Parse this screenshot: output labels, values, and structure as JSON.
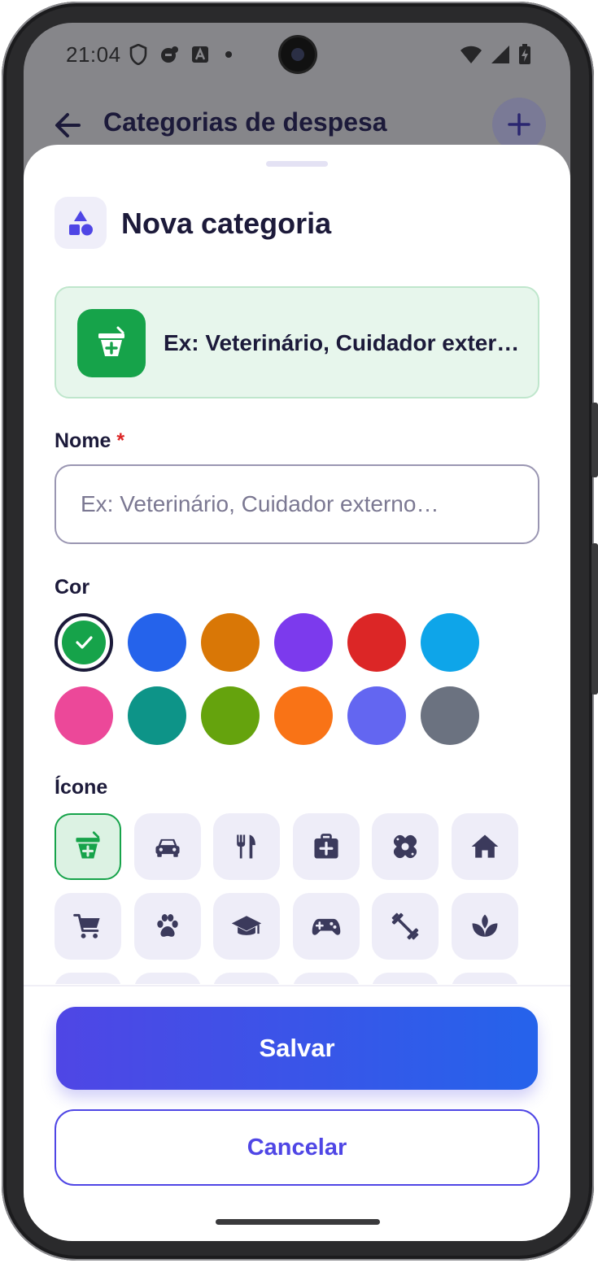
{
  "status_bar": {
    "time": "21:04",
    "icons_left": [
      "shield-icon",
      "notification-icon",
      "a-badge-icon",
      "dot-icon"
    ],
    "icons_right": [
      "wifi-icon",
      "signal-icon",
      "battery-charging-icon"
    ]
  },
  "app_bar": {
    "back_icon": "arrow-left-icon",
    "title": "Categorias de despesa",
    "add_icon": "plus-icon"
  },
  "sheet": {
    "header_icon": "shapes-icon",
    "title": "Nova categoria",
    "preview": {
      "icon": "pharmacy-icon",
      "color": "#16a34a",
      "text": "Ex: Veterinário, Cuidador exter…"
    },
    "name_field": {
      "label": "Nome",
      "required_mark": "*",
      "value": "",
      "placeholder": "Ex: Veterinário, Cuidador externo…"
    },
    "color_section": {
      "label": "Cor",
      "selected_index": 0,
      "colors": [
        "#16a34a",
        "#2563eb",
        "#d97706",
        "#7c3aed",
        "#dc2626",
        "#0ea5e9",
        "#ec4899",
        "#0d9488",
        "#65a30d",
        "#f97316",
        "#6366f1",
        "#6b7280"
      ]
    },
    "icon_section": {
      "label": "Ícone",
      "selected_index": 0,
      "icons": [
        "pharmacy-icon",
        "car-icon",
        "restaurant-icon",
        "medical-bag-icon",
        "bandage-icon",
        "home-icon",
        "shopping-cart-icon",
        "paw-icon",
        "graduation-cap-icon",
        "gamepad-icon",
        "dumbbell-icon",
        "spa-icon"
      ]
    },
    "save_label": "Salvar",
    "cancel_label": "Cancelar"
  },
  "colors": {
    "accent": "#4f46e5",
    "accent_end": "#2563eb",
    "text_dark": "#1c1a3a"
  }
}
